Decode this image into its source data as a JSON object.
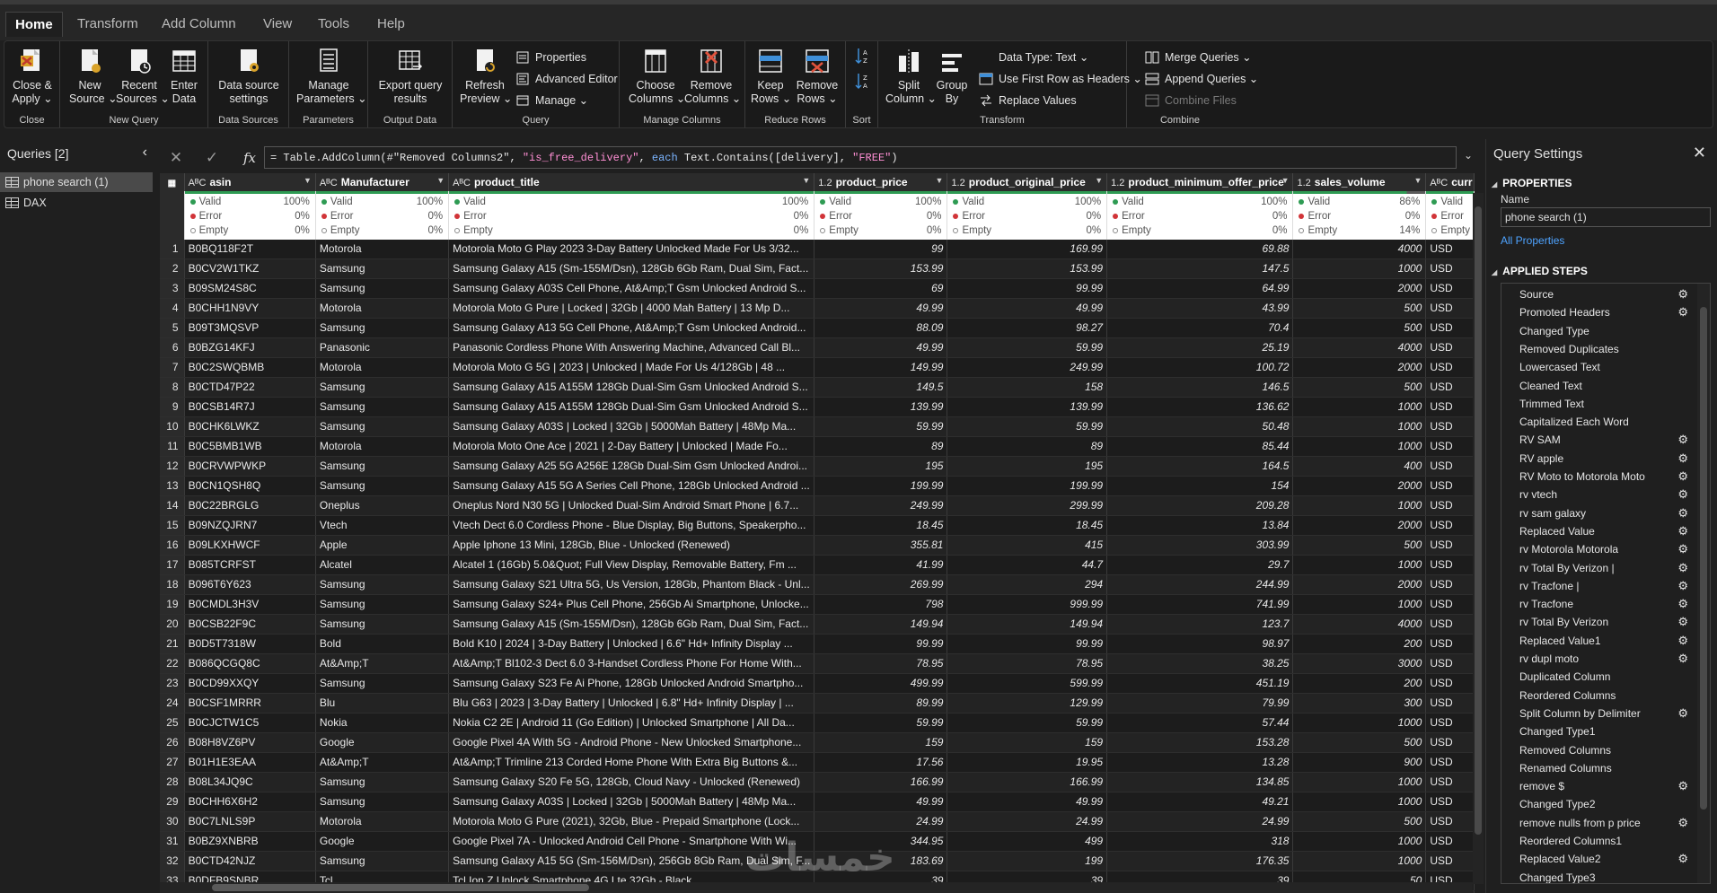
{
  "menu": {
    "tabs": [
      "Home",
      "Transform",
      "Add Column",
      "View",
      "Tools",
      "Help"
    ],
    "active": "Home"
  },
  "ribbon": {
    "groups": {
      "close": "Close",
      "new_query": "New Query",
      "data_sources": "Data Sources",
      "parameters": "Parameters",
      "output_data": "Output Data",
      "query": "Query",
      "manage_columns": "Manage Columns",
      "reduce_rows": "Reduce Rows",
      "sort": "Sort",
      "transform": "Transform",
      "combine": "Combine"
    },
    "buttons": {
      "close_apply": [
        "Close &",
        "Apply ⌄"
      ],
      "new_source": [
        "New",
        "Source ⌄"
      ],
      "recent_sources": [
        "Recent",
        "Sources ⌄"
      ],
      "enter_data": [
        "Enter",
        "Data"
      ],
      "data_source_settings": [
        "Data source",
        "settings"
      ],
      "manage_parameters": [
        "Manage",
        "Parameters ⌄"
      ],
      "export_query_results": [
        "Export query",
        "results"
      ],
      "refresh_preview": [
        "Refresh",
        "Preview ⌄"
      ],
      "properties": "Properties",
      "advanced_editor": "Advanced Editor",
      "manage": "Manage ⌄",
      "choose_columns": [
        "Choose",
        "Columns ⌄"
      ],
      "remove_columns": [
        "Remove",
        "Columns ⌄"
      ],
      "keep_rows": [
        "Keep",
        "Rows ⌄"
      ],
      "remove_rows": [
        "Remove",
        "Rows ⌄"
      ],
      "split_column": [
        "Split",
        "Column ⌄"
      ],
      "group_by": [
        "Group",
        "By"
      ],
      "data_type": "Data Type: Text ⌄",
      "use_first_row": "Use First Row as Headers ⌄",
      "replace_values": "Replace Values",
      "merge_queries": "Merge Queries ⌄",
      "append_queries": "Append Queries ⌄",
      "combine_files": "Combine Files"
    }
  },
  "queries": {
    "title": "Queries [2]",
    "items": [
      "phone search (1)",
      "DAX"
    ]
  },
  "formula": {
    "text_parts": [
      {
        "t": "= Table.AddColumn(#\"Removed Columns2\", ",
        "c": ""
      },
      {
        "t": "\"is_free_delivery\"",
        "c": "str"
      },
      {
        "t": ", ",
        "c": ""
      },
      {
        "t": "each",
        "c": "kw"
      },
      {
        "t": " Text.Contains([delivery], ",
        "c": ""
      },
      {
        "t": "\"FREE\"",
        "c": "str"
      },
      {
        "t": ")",
        "c": ""
      }
    ]
  },
  "table": {
    "columns": [
      {
        "type": "AᴮC",
        "name": "asin",
        "valid": "100%",
        "error": "0%",
        "empty": "0%"
      },
      {
        "type": "AᴮC",
        "name": "Manufacturer",
        "valid": "100%",
        "error": "0%",
        "empty": "0%"
      },
      {
        "type": "AᴮC",
        "name": "product_title",
        "valid": "100%",
        "error": "0%",
        "empty": "0%"
      },
      {
        "type": "1.2",
        "name": "product_price",
        "valid": "100%",
        "error": "0%",
        "empty": "0%"
      },
      {
        "type": "1.2",
        "name": "product_original_price",
        "valid": "100%",
        "error": "0%",
        "empty": "0%"
      },
      {
        "type": "1.2",
        "name": "product_minimum_offer_price",
        "valid": "100%",
        "error": "0%",
        "empty": "0%"
      },
      {
        "type": "1.2",
        "name": "sales_volume",
        "valid": "86%",
        "error": "0%",
        "empty": "14%"
      },
      {
        "type": "AᴮC",
        "name": "curr",
        "valid": "",
        "error": "",
        "empty": ""
      }
    ],
    "quality_labels": {
      "valid": "Valid",
      "error": "Error",
      "empty": "Empty"
    },
    "rows": [
      [
        "B0BQ118F2T",
        "Motorola",
        "Motorola Moto G Play 2023 3-Day Battery Unlocked Made For Us 3/32...",
        "99",
        "169.99",
        "69.88",
        "4000",
        "USD"
      ],
      [
        "B0CV2W1TKZ",
        "Samsung",
        "Samsung Galaxy A15 (Sm-155M/Dsn), 128Gb 6Gb Ram, Dual Sim, Fact...",
        "153.99",
        "153.99",
        "147.5",
        "1000",
        "USD"
      ],
      [
        "B09SM24S8C",
        "Samsung",
        "Samsung Galaxy A03S Cell Phone, At&Amp;T Gsm Unlocked Android S...",
        "69",
        "99.99",
        "64.99",
        "2000",
        "USD"
      ],
      [
        "B0CHH1N9VY",
        "Motorola",
        "Motorola Moto G Pure | Locked | 32Gb | 4000 Mah Battery | 13 Mp D...",
        "49.99",
        "49.99",
        "43.99",
        "500",
        "USD"
      ],
      [
        "B09T3MQSVP",
        "Samsung",
        "Samsung Galaxy A13 5G Cell Phone, At&Amp;T Gsm Unlocked Android...",
        "88.09",
        "98.27",
        "70.4",
        "500",
        "USD"
      ],
      [
        "B0BZG14KFJ",
        "Panasonic",
        "Panasonic Cordless Phone With Answering Machine, Advanced Call Bl...",
        "49.99",
        "59.99",
        "25.19",
        "4000",
        "USD"
      ],
      [
        "B0C2SWQBMB",
        "Motorola",
        "Motorola Moto G 5G | 2023 | Unlocked | Made For Us 4/128Gb | 48 ...",
        "149.99",
        "249.99",
        "100.72",
        "2000",
        "USD"
      ],
      [
        "B0CTD47P22",
        "Samsung",
        "Samsung Galaxy A15 A155M 128Gb Dual-Sim Gsm Unlocked Android S...",
        "149.5",
        "158",
        "146.5",
        "500",
        "USD"
      ],
      [
        "B0CSB14R7J",
        "Samsung",
        "Samsung Galaxy A15 A155M 128Gb Dual-Sim Gsm Unlocked Android S...",
        "139.99",
        "139.99",
        "136.62",
        "1000",
        "USD"
      ],
      [
        "B0CHK6LWKZ",
        "Samsung",
        "Samsung Galaxy A03S | Locked | 32Gb | 5000Mah Battery | 48Mp Ma...",
        "59.99",
        "59.99",
        "50.48",
        "1000",
        "USD"
      ],
      [
        "B0C5BMB1WB",
        "Motorola",
        "Motorola Moto One Ace | 2021 | 2-Day Battery | Unlocked | Made Fo...",
        "89",
        "89",
        "85.44",
        "1000",
        "USD"
      ],
      [
        "B0CRVWPWKP",
        "Samsung",
        "Samsung Galaxy A25 5G A256E 128Gb Dual-Sim Gsm Unlocked Androi...",
        "195",
        "195",
        "164.5",
        "400",
        "USD"
      ],
      [
        "B0CN1QSH8Q",
        "Samsung",
        "Samsung Galaxy A15 5G A Series Cell Phone, 128Gb Unlocked Android ...",
        "199.99",
        "199.99",
        "154",
        "2000",
        "USD"
      ],
      [
        "B0C22BRGLG",
        "Oneplus",
        "Oneplus Nord N30 5G | Unlocked Dual-Sim Android Smart Phone | 6.7...",
        "249.99",
        "299.99",
        "209.28",
        "1000",
        "USD"
      ],
      [
        "B09NZQJRN7",
        "Vtech",
        "Vtech Dect 6.0 Cordless Phone - Blue Display, Big Buttons, Speakerpho...",
        "18.45",
        "18.45",
        "13.84",
        "2000",
        "USD"
      ],
      [
        "B09LKXHWCF",
        "Apple",
        "Apple Iphone 13 Mini, 128Gb, Blue - Unlocked (Renewed)",
        "355.81",
        "415",
        "303.99",
        "500",
        "USD"
      ],
      [
        "B085TCRFST",
        "Alcatel",
        "Alcatel 1 (16Gb) 5.0&Quot; Full View Display, Removable Battery, Fm ...",
        "41.99",
        "44.7",
        "29.7",
        "1000",
        "USD"
      ],
      [
        "B096T6Y623",
        "Samsung",
        "Samsung Galaxy S21 Ultra 5G, Us Version, 128Gb, Phantom Black - Unl...",
        "269.99",
        "294",
        "244.99",
        "2000",
        "USD"
      ],
      [
        "B0CMDL3H3V",
        "Samsung",
        "Samsung Galaxy S24+ Plus Cell Phone, 256Gb Ai Smartphone, Unlocke...",
        "798",
        "999.99",
        "741.99",
        "1000",
        "USD"
      ],
      [
        "B0CSB22F9C",
        "Samsung",
        "Samsung Galaxy A15 (Sm-155M/Dsn), 128Gb 6Gb Ram, Dual Sim, Fact...",
        "149.94",
        "149.94",
        "123.7",
        "4000",
        "USD"
      ],
      [
        "B0D5T7318W",
        "Bold",
        "Bold K10 | 2024 | 3-Day Battery | Unlocked | 6.6\" Hd+ Infinity Display ...",
        "99.99",
        "99.99",
        "98.97",
        "200",
        "USD"
      ],
      [
        "B086QCGQ8C",
        "At&Amp;T",
        "At&Amp;T Bl102-3 Dect 6.0 3-Handset Cordless Phone For Home With...",
        "78.95",
        "78.95",
        "38.25",
        "3000",
        "USD"
      ],
      [
        "B0CD99XXQY",
        "Samsung",
        "Samsung Galaxy S23 Fe Ai Phone, 128Gb Unlocked Android Smartpho...",
        "499.99",
        "599.99",
        "451.19",
        "200",
        "USD"
      ],
      [
        "B0CSF1MRRR",
        "Blu",
        "Blu G63 | 2023 | 3-Day Battery | Unlocked | 6.8\" Hd+ Infinity Display | ...",
        "89.99",
        "129.99",
        "79.99",
        "300",
        "USD"
      ],
      [
        "B0CJCTW1C5",
        "Nokia",
        "Nokia C2 2E | Android 11 (Go Edition) | Unlocked Smartphone | All Da...",
        "59.99",
        "59.99",
        "57.44",
        "1000",
        "USD"
      ],
      [
        "B08H8VZ6PV",
        "Google",
        "Google Pixel 4A With 5G - Android Phone - New Unlocked Smartphone...",
        "159",
        "159",
        "153.28",
        "500",
        "USD"
      ],
      [
        "B01H1E3EAA",
        "At&Amp;T",
        "At&Amp;T Trimline 213 Corded Home Phone With Extra Big Buttons &...",
        "17.56",
        "19.95",
        "13.28",
        "900",
        "USD"
      ],
      [
        "B08L34JQ9C",
        "Samsung",
        "Samsung Galaxy S20 Fe 5G, 128Gb, Cloud Navy - Unlocked (Renewed)",
        "166.99",
        "166.99",
        "134.85",
        "1000",
        "USD"
      ],
      [
        "B0CHH6X6H2",
        "Samsung",
        "Samsung Galaxy A03S | Locked | 32Gb | 5000Mah Battery | 48Mp Ma...",
        "49.99",
        "49.99",
        "49.21",
        "1000",
        "USD"
      ],
      [
        "B0C7LNLS9P",
        "Motorola",
        "Motorola Moto G Pure (2021), 32Gb, Blue - Prepaid Smartphone (Lock...",
        "24.99",
        "24.99",
        "24.99",
        "500",
        "USD"
      ],
      [
        "B0BZ9XNBRB",
        "Google",
        "Google Pixel 7A - Unlocked Android Cell Phone - Smartphone With Wi...",
        "344.95",
        "499",
        "318",
        "1000",
        "USD"
      ],
      [
        "B0CTD42NJZ",
        "Samsung",
        "Samsung Galaxy A15 5G (Sm-156M/Dsn), 256Gb 8Gb Ram, Dual Sim, F...",
        "183.69",
        "199",
        "176.35",
        "1000",
        "USD"
      ],
      [
        "B0DFB9SNBR",
        "Tcl",
        "Tcl Ion Z Unlock Smartphone 4G Lte 32Gb - Black",
        "39",
        "39",
        "39",
        "50",
        "USD"
      ],
      [
        "",
        "",
        "",
        "",
        "",
        "",
        "",
        ""
      ]
    ]
  },
  "settings": {
    "title": "Query Settings",
    "properties_title": "PROPERTIES",
    "name_label": "Name",
    "name_value": "phone search (1)",
    "all_properties": "All Properties",
    "applied_steps_title": "APPLIED STEPS",
    "steps": [
      {
        "name": "Source",
        "gear": true
      },
      {
        "name": "Promoted Headers",
        "gear": true
      },
      {
        "name": "Changed Type",
        "gear": false
      },
      {
        "name": "Removed Duplicates",
        "gear": false
      },
      {
        "name": "Lowercased Text",
        "gear": false
      },
      {
        "name": "Cleaned Text",
        "gear": false
      },
      {
        "name": "Trimmed Text",
        "gear": false
      },
      {
        "name": "Capitalized Each Word",
        "gear": false
      },
      {
        "name": "RV SAM",
        "gear": true
      },
      {
        "name": "RV apple",
        "gear": true
      },
      {
        "name": "RV Moto to Motorola Moto",
        "gear": true
      },
      {
        "name": "rv vtech",
        "gear": true
      },
      {
        "name": "rv sam galaxy",
        "gear": true
      },
      {
        "name": "Replaced Value",
        "gear": true
      },
      {
        "name": "rv Motorola Motorola",
        "gear": true
      },
      {
        "name": "rv Total By Verizon |",
        "gear": true
      },
      {
        "name": "rv Tracfone |",
        "gear": true
      },
      {
        "name": "rv Tracfone",
        "gear": true
      },
      {
        "name": "rv Total By Verizon",
        "gear": true
      },
      {
        "name": "Replaced Value1",
        "gear": true
      },
      {
        "name": "rv dupl moto",
        "gear": true
      },
      {
        "name": "Duplicated Column",
        "gear": false
      },
      {
        "name": "Reordered Columns",
        "gear": false
      },
      {
        "name": "Split Column by Delimiter",
        "gear": true
      },
      {
        "name": "Changed Type1",
        "gear": false
      },
      {
        "name": "Removed Columns",
        "gear": false
      },
      {
        "name": "Renamed Columns",
        "gear": false
      },
      {
        "name": "remove $",
        "gear": true
      },
      {
        "name": "Changed Type2",
        "gear": false
      },
      {
        "name": "remove nulls from p price",
        "gear": true
      },
      {
        "name": "Reordered Columns1",
        "gear": false
      },
      {
        "name": "Replaced Value2",
        "gear": true
      },
      {
        "name": "Changed Type3",
        "gear": false
      }
    ]
  },
  "watermark": "خمسات",
  "colors": {
    "accent": "#2e9b53",
    "link": "#4ea3ff",
    "selected": "#4a4a4a"
  }
}
